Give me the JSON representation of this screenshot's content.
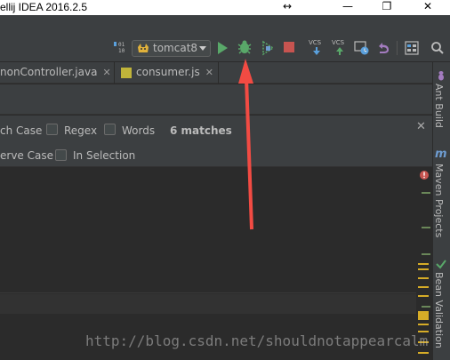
{
  "window": {
    "title": "ellij IDEA 2016.2.5",
    "restore_glyph": "↔",
    "minimize_glyph": "—",
    "maximize_glyph": "❐",
    "close_glyph": "✕"
  },
  "toolbar": {
    "run_config": "tomcat8",
    "vcs_update_label": "VCS",
    "vcs_commit_label": "VCS"
  },
  "tabs": [
    {
      "label": "nonController.java"
    },
    {
      "label": "consumer.js"
    }
  ],
  "find": {
    "match_case_label": "ch Case",
    "regex_label": "Regex",
    "words_label": "Words",
    "matches": "6 matches",
    "preserve_case_label": "erve Case",
    "in_selection_label": "In Selection"
  },
  "right_strip": {
    "ant_build": "Ant Build",
    "maven_projects": "Maven Projects",
    "bean_validation": "Bean Validation"
  },
  "watermark": "http://blog.csdn.net/shouldnotappearcalm",
  "colors": {
    "accent_red_arrow": "#f24b43",
    "run_green": "#59a869",
    "stop_red": "#c75450",
    "find_match_yellow": "#d6ac27"
  }
}
